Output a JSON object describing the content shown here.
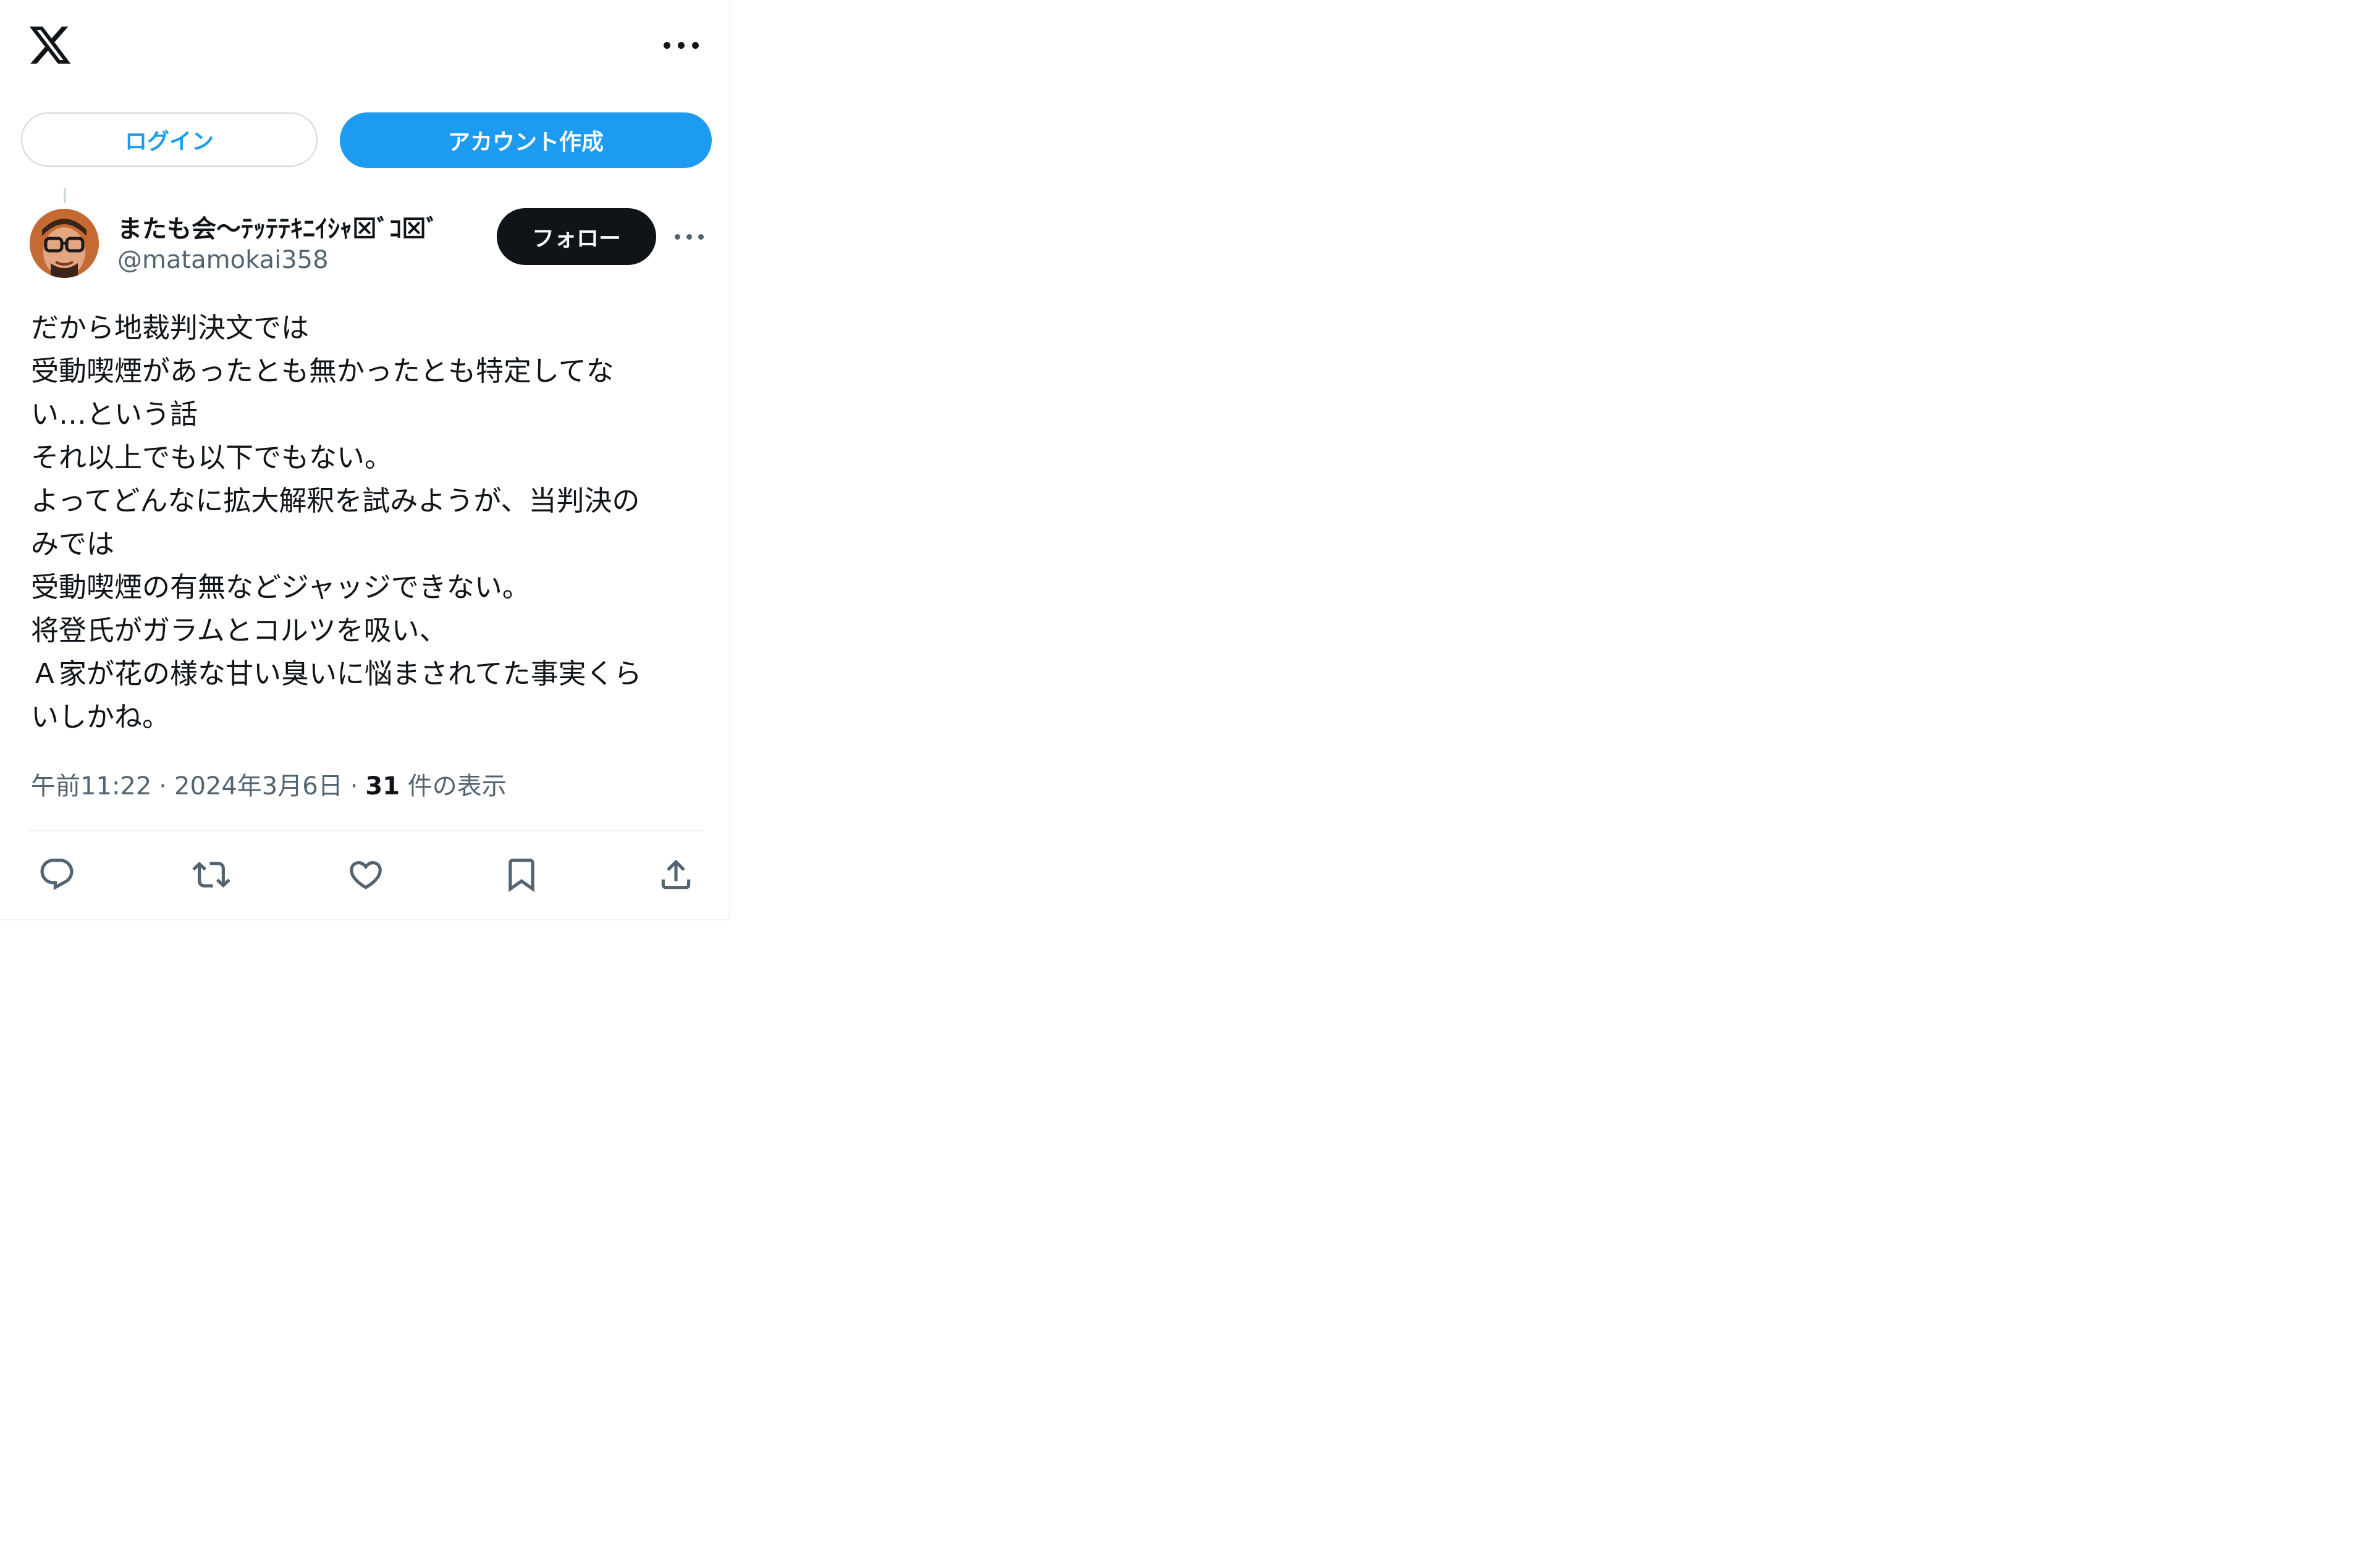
{
  "header": {
    "logo_icon": "x-logo-icon",
    "more_icon": "more-horizontal-icon"
  },
  "auth": {
    "login_label": "ログイン",
    "signup_label": "アカウント作成"
  },
  "tweet": {
    "author": {
      "display_name": "またも会〜ﾃｯﾃﾃｷﾆｲｼｬ⊠ﾞｺ⊠ﾞ",
      "handle": "@matamokai358"
    },
    "follow_label": "フォロー",
    "text_lines": [
      "だから地裁判決文では",
      "受動喫煙があったとも無かったとも特定してな",
      "い…という話",
      "それ以上でも以下でもない。",
      "よってどんなに拡大解釈を試みようが、当判決の",
      "みでは",
      "受動喫煙の有無などジャッジできない。",
      "将登氏がガラムとコルツを吸い、",
      "Ａ家が花の様な甘い臭いに悩まされてた事実くら",
      "いしかね。"
    ],
    "time": "午前11:22",
    "date": "2024年3月6日",
    "views_count": "31",
    "views_label": "件の表示",
    "separator": "·"
  },
  "actions": {
    "reply_icon": "reply-icon",
    "retweet_icon": "retweet-icon",
    "like_icon": "heart-icon",
    "bookmark_icon": "bookmark-icon",
    "share_icon": "share-icon"
  },
  "colors": {
    "accent": "#1d9bf0",
    "text_primary": "#0f1419",
    "text_secondary": "#536471",
    "border": "#cfd9de"
  }
}
